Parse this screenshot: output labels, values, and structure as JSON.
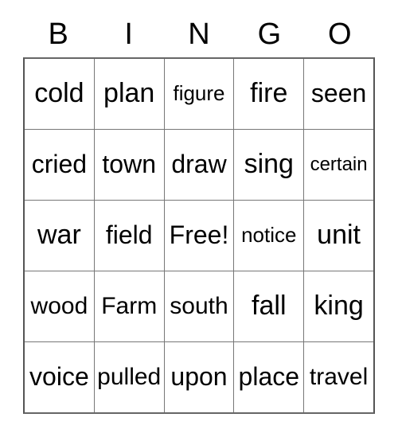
{
  "card": {
    "header_letters": [
      "B",
      "I",
      "N",
      "G",
      "O"
    ],
    "columns": [
      "B",
      "I",
      "N",
      "G",
      "O"
    ],
    "free_space_label": "Free!",
    "rows": [
      [
        {
          "text": "cold",
          "size": "fs-xl"
        },
        {
          "text": "plan",
          "size": "fs-xl"
        },
        {
          "text": "figure",
          "size": "fs-sm"
        },
        {
          "text": "fire",
          "size": "fs-xl"
        },
        {
          "text": "seen",
          "size": "fs-lg"
        }
      ],
      [
        {
          "text": "cried",
          "size": "fs-lg"
        },
        {
          "text": "town",
          "size": "fs-lg"
        },
        {
          "text": "draw",
          "size": "fs-lg"
        },
        {
          "text": "sing",
          "size": "fs-xl"
        },
        {
          "text": "certain",
          "size": "fs-xs"
        }
      ],
      [
        {
          "text": "war",
          "size": "fs-xl"
        },
        {
          "text": "field",
          "size": "fs-lg"
        },
        {
          "text": "Free!",
          "size": "fs-lg"
        },
        {
          "text": "notice",
          "size": "fs-sm"
        },
        {
          "text": "unit",
          "size": "fs-xl"
        }
      ],
      [
        {
          "text": "wood",
          "size": "fs-md"
        },
        {
          "text": "Farm",
          "size": "fs-md"
        },
        {
          "text": "south",
          "size": "fs-md"
        },
        {
          "text": "fall",
          "size": "fs-xl"
        },
        {
          "text": "king",
          "size": "fs-xl"
        }
      ],
      [
        {
          "text": "voice",
          "size": "fs-lg"
        },
        {
          "text": "pulled",
          "size": "fs-md"
        },
        {
          "text": "upon",
          "size": "fs-lg"
        },
        {
          "text": "place",
          "size": "fs-lg"
        },
        {
          "text": "travel",
          "size": "fs-md"
        }
      ]
    ]
  },
  "colors": {
    "background": "#ffffff",
    "text": "#000000",
    "grid_border": "#555555",
    "grid_line": "#777777"
  }
}
